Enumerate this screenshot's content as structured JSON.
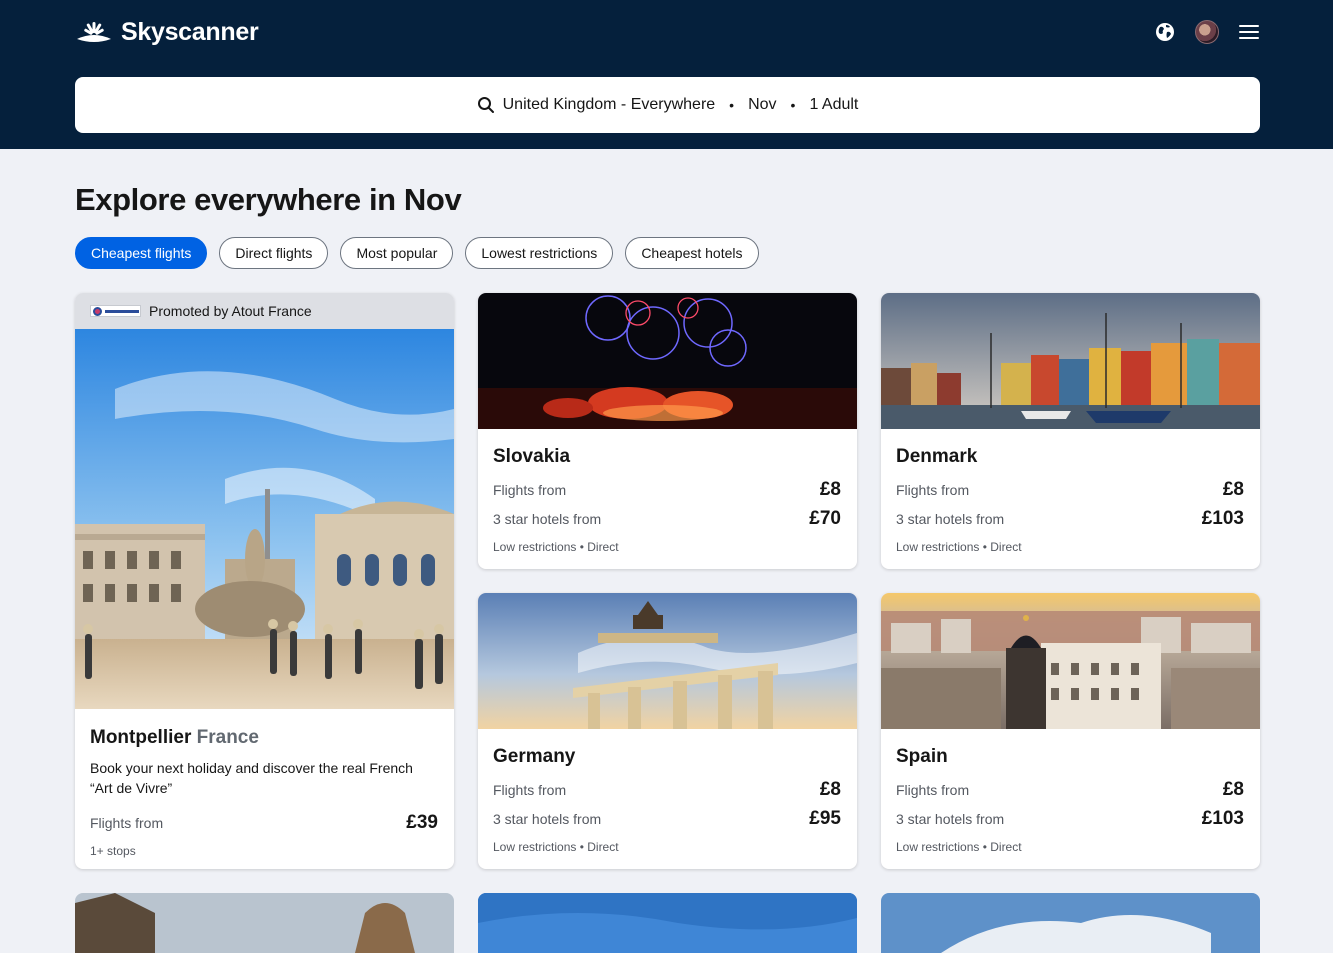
{
  "header": {
    "brand": "Skyscanner",
    "icons": [
      "globe-icon",
      "avatar",
      "menu-icon"
    ]
  },
  "search": {
    "route": "United Kingdom - Everywhere",
    "month": "Nov",
    "passengers": "1 Adult",
    "separator": "•"
  },
  "title": "Explore everywhere in Nov",
  "filters": [
    {
      "label": "Cheapest flights",
      "active": true
    },
    {
      "label": "Direct flights",
      "active": false
    },
    {
      "label": "Most popular",
      "active": false
    },
    {
      "label": "Lowest restrictions",
      "active": false
    },
    {
      "label": "Cheapest hotels",
      "active": false
    }
  ],
  "promo": {
    "sponsor": "Promoted by Atout France",
    "city": "Montpellier",
    "country": "France",
    "description": "Book your next holiday and discover the real French “Art de Vivre”",
    "flights_label": "Flights from",
    "flights_price": "£39",
    "stops": "1+ stops"
  },
  "destinations": [
    {
      "name": "Slovakia",
      "flights_label": "Flights from",
      "flights_price": "£8",
      "hotels_label": "3 star hotels from",
      "hotels_price": "£70",
      "tags": "Low restrictions • Direct"
    },
    {
      "name": "Denmark",
      "flights_label": "Flights from",
      "flights_price": "£8",
      "hotels_label": "3 star hotels from",
      "hotels_price": "£103",
      "tags": "Low restrictions • Direct"
    },
    {
      "name": "Germany",
      "flights_label": "Flights from",
      "flights_price": "£8",
      "hotels_label": "3 star hotels from",
      "hotels_price": "£95",
      "tags": "Low restrictions • Direct"
    },
    {
      "name": "Spain",
      "flights_label": "Flights from",
      "flights_price": "£8",
      "hotels_label": "3 star hotels from",
      "hotels_price": "£103",
      "tags": "Low restrictions • Direct"
    }
  ],
  "colors": {
    "header_bg": "#05203c",
    "accent": "#0062e3",
    "page_bg": "#eff1f6"
  }
}
